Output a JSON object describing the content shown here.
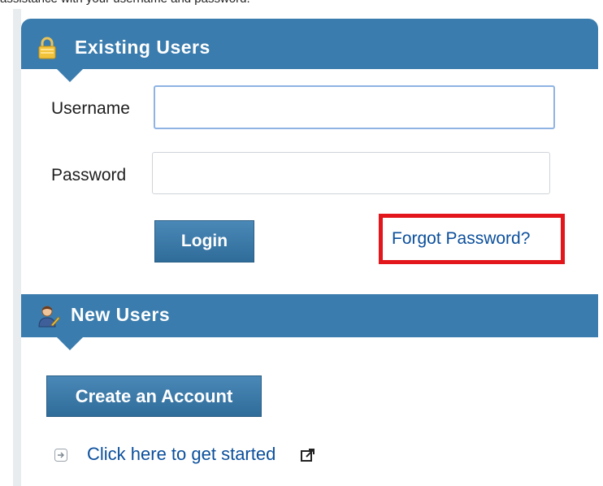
{
  "top_text": "assistance with your username and password.",
  "existing_users": {
    "title": "Existing Users",
    "username_label": "Username",
    "password_label": "Password",
    "username_value": "",
    "password_value": "",
    "login_label": "Login",
    "forgot_password": "Forgot Password?",
    "lock_icon": "lock-icon"
  },
  "new_users": {
    "title": "New Users",
    "create_account_label": "Create an Account",
    "get_started_link": "Click here to get started",
    "user_icon": "user-icon",
    "external_icon": "external-link-icon"
  },
  "colors": {
    "header_blue": "#3a7cad",
    "link_blue": "#0b4f9c",
    "highlight_red": "#e3161c"
  }
}
